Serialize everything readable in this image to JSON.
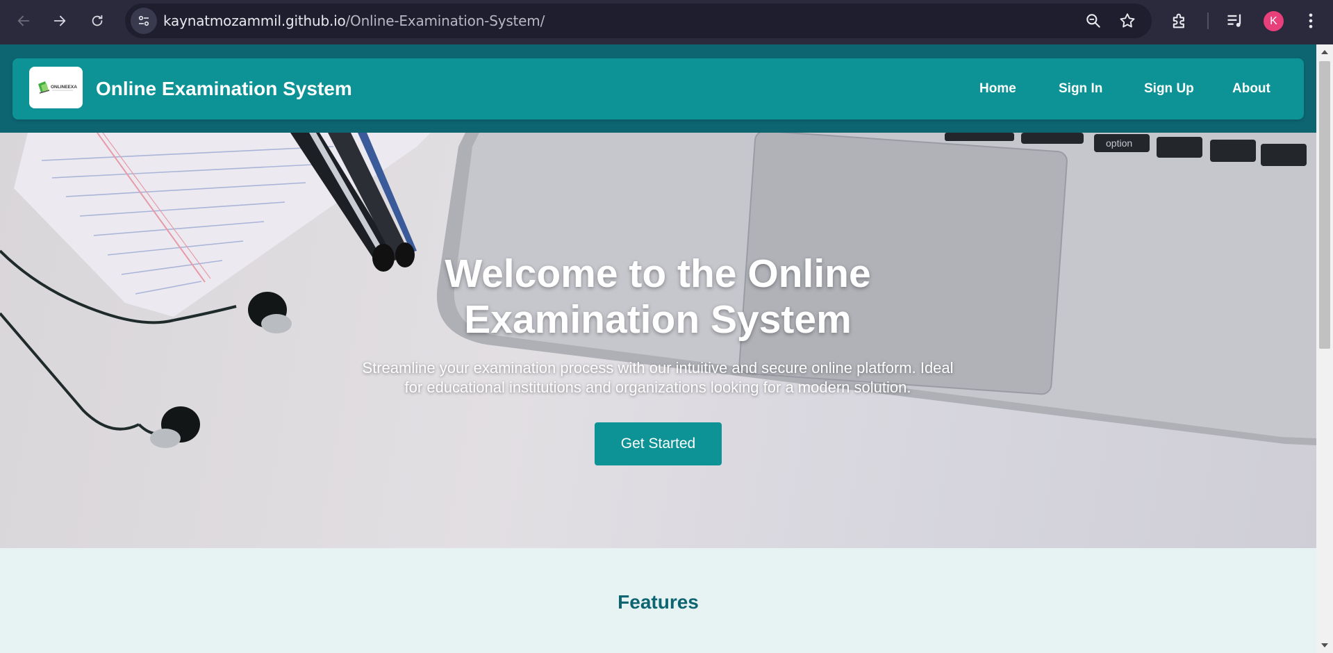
{
  "browser": {
    "url_host": "kaynatmozammil.github.io",
    "url_path": "/Online-Examination-System/",
    "profile_initial": "K",
    "colors": {
      "chrome": "#2a2a3c",
      "profile": "#e8407a"
    },
    "icons": [
      "back-icon",
      "forward-icon",
      "reload-icon",
      "site-info-icon",
      "zoom-icon",
      "bookmark-star-icon",
      "extensions-icon",
      "media-controls-icon",
      "menu-kebab-icon"
    ]
  },
  "navbar": {
    "logo_text": "ONLINEEXAM",
    "title": "Online Examination System",
    "links": [
      {
        "label": "Home"
      },
      {
        "label": "Sign In"
      },
      {
        "label": "Sign Up"
      },
      {
        "label": "About"
      }
    ],
    "colors": {
      "bar": "#0d9396",
      "band": "#0d6572"
    }
  },
  "hero": {
    "title_line1": "Welcome to the Online",
    "title_line2": "Examination System",
    "subtitle_line1": "Streamline your examination process with our intuitive and secure online platform. Ideal",
    "subtitle_line2": "for educational institutions and organizations looking for a modern solution.",
    "cta_label": "Get Started",
    "cta_color": "#0d9396"
  },
  "features": {
    "title": "Features",
    "background": "#e7f3f3"
  }
}
